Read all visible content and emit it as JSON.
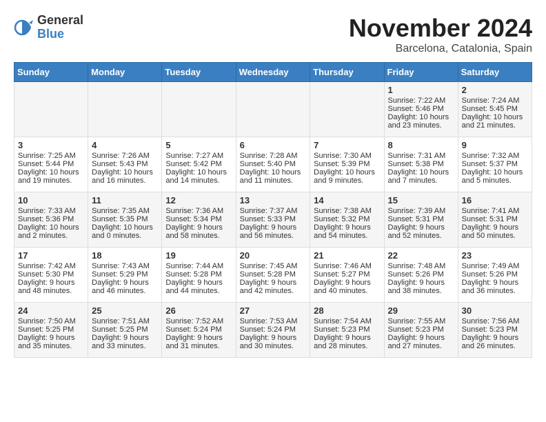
{
  "logo": {
    "line1": "General",
    "line2": "Blue"
  },
  "title": "November 2024",
  "location": "Barcelona, Catalonia, Spain",
  "weekdays": [
    "Sunday",
    "Monday",
    "Tuesday",
    "Wednesday",
    "Thursday",
    "Friday",
    "Saturday"
  ],
  "weeks": [
    [
      {
        "day": "",
        "sunrise": "",
        "sunset": "",
        "daylight": ""
      },
      {
        "day": "",
        "sunrise": "",
        "sunset": "",
        "daylight": ""
      },
      {
        "day": "",
        "sunrise": "",
        "sunset": "",
        "daylight": ""
      },
      {
        "day": "",
        "sunrise": "",
        "sunset": "",
        "daylight": ""
      },
      {
        "day": "",
        "sunrise": "",
        "sunset": "",
        "daylight": ""
      },
      {
        "day": "1",
        "sunrise": "Sunrise: 7:22 AM",
        "sunset": "Sunset: 5:46 PM",
        "daylight": "Daylight: 10 hours and 23 minutes."
      },
      {
        "day": "2",
        "sunrise": "Sunrise: 7:24 AM",
        "sunset": "Sunset: 5:45 PM",
        "daylight": "Daylight: 10 hours and 21 minutes."
      }
    ],
    [
      {
        "day": "3",
        "sunrise": "Sunrise: 7:25 AM",
        "sunset": "Sunset: 5:44 PM",
        "daylight": "Daylight: 10 hours and 19 minutes."
      },
      {
        "day": "4",
        "sunrise": "Sunrise: 7:26 AM",
        "sunset": "Sunset: 5:43 PM",
        "daylight": "Daylight: 10 hours and 16 minutes."
      },
      {
        "day": "5",
        "sunrise": "Sunrise: 7:27 AM",
        "sunset": "Sunset: 5:42 PM",
        "daylight": "Daylight: 10 hours and 14 minutes."
      },
      {
        "day": "6",
        "sunrise": "Sunrise: 7:28 AM",
        "sunset": "Sunset: 5:40 PM",
        "daylight": "Daylight: 10 hours and 11 minutes."
      },
      {
        "day": "7",
        "sunrise": "Sunrise: 7:30 AM",
        "sunset": "Sunset: 5:39 PM",
        "daylight": "Daylight: 10 hours and 9 minutes."
      },
      {
        "day": "8",
        "sunrise": "Sunrise: 7:31 AM",
        "sunset": "Sunset: 5:38 PM",
        "daylight": "Daylight: 10 hours and 7 minutes."
      },
      {
        "day": "9",
        "sunrise": "Sunrise: 7:32 AM",
        "sunset": "Sunset: 5:37 PM",
        "daylight": "Daylight: 10 hours and 5 minutes."
      }
    ],
    [
      {
        "day": "10",
        "sunrise": "Sunrise: 7:33 AM",
        "sunset": "Sunset: 5:36 PM",
        "daylight": "Daylight: 10 hours and 2 minutes."
      },
      {
        "day": "11",
        "sunrise": "Sunrise: 7:35 AM",
        "sunset": "Sunset: 5:35 PM",
        "daylight": "Daylight: 10 hours and 0 minutes."
      },
      {
        "day": "12",
        "sunrise": "Sunrise: 7:36 AM",
        "sunset": "Sunset: 5:34 PM",
        "daylight": "Daylight: 9 hours and 58 minutes."
      },
      {
        "day": "13",
        "sunrise": "Sunrise: 7:37 AM",
        "sunset": "Sunset: 5:33 PM",
        "daylight": "Daylight: 9 hours and 56 minutes."
      },
      {
        "day": "14",
        "sunrise": "Sunrise: 7:38 AM",
        "sunset": "Sunset: 5:32 PM",
        "daylight": "Daylight: 9 hours and 54 minutes."
      },
      {
        "day": "15",
        "sunrise": "Sunrise: 7:39 AM",
        "sunset": "Sunset: 5:31 PM",
        "daylight": "Daylight: 9 hours and 52 minutes."
      },
      {
        "day": "16",
        "sunrise": "Sunrise: 7:41 AM",
        "sunset": "Sunset: 5:31 PM",
        "daylight": "Daylight: 9 hours and 50 minutes."
      }
    ],
    [
      {
        "day": "17",
        "sunrise": "Sunrise: 7:42 AM",
        "sunset": "Sunset: 5:30 PM",
        "daylight": "Daylight: 9 hours and 48 minutes."
      },
      {
        "day": "18",
        "sunrise": "Sunrise: 7:43 AM",
        "sunset": "Sunset: 5:29 PM",
        "daylight": "Daylight: 9 hours and 46 minutes."
      },
      {
        "day": "19",
        "sunrise": "Sunrise: 7:44 AM",
        "sunset": "Sunset: 5:28 PM",
        "daylight": "Daylight: 9 hours and 44 minutes."
      },
      {
        "day": "20",
        "sunrise": "Sunrise: 7:45 AM",
        "sunset": "Sunset: 5:28 PM",
        "daylight": "Daylight: 9 hours and 42 minutes."
      },
      {
        "day": "21",
        "sunrise": "Sunrise: 7:46 AM",
        "sunset": "Sunset: 5:27 PM",
        "daylight": "Daylight: 9 hours and 40 minutes."
      },
      {
        "day": "22",
        "sunrise": "Sunrise: 7:48 AM",
        "sunset": "Sunset: 5:26 PM",
        "daylight": "Daylight: 9 hours and 38 minutes."
      },
      {
        "day": "23",
        "sunrise": "Sunrise: 7:49 AM",
        "sunset": "Sunset: 5:26 PM",
        "daylight": "Daylight: 9 hours and 36 minutes."
      }
    ],
    [
      {
        "day": "24",
        "sunrise": "Sunrise: 7:50 AM",
        "sunset": "Sunset: 5:25 PM",
        "daylight": "Daylight: 9 hours and 35 minutes."
      },
      {
        "day": "25",
        "sunrise": "Sunrise: 7:51 AM",
        "sunset": "Sunset: 5:25 PM",
        "daylight": "Daylight: 9 hours and 33 minutes."
      },
      {
        "day": "26",
        "sunrise": "Sunrise: 7:52 AM",
        "sunset": "Sunset: 5:24 PM",
        "daylight": "Daylight: 9 hours and 31 minutes."
      },
      {
        "day": "27",
        "sunrise": "Sunrise: 7:53 AM",
        "sunset": "Sunset: 5:24 PM",
        "daylight": "Daylight: 9 hours and 30 minutes."
      },
      {
        "day": "28",
        "sunrise": "Sunrise: 7:54 AM",
        "sunset": "Sunset: 5:23 PM",
        "daylight": "Daylight: 9 hours and 28 minutes."
      },
      {
        "day": "29",
        "sunrise": "Sunrise: 7:55 AM",
        "sunset": "Sunset: 5:23 PM",
        "daylight": "Daylight: 9 hours and 27 minutes."
      },
      {
        "day": "30",
        "sunrise": "Sunrise: 7:56 AM",
        "sunset": "Sunset: 5:23 PM",
        "daylight": "Daylight: 9 hours and 26 minutes."
      }
    ]
  ]
}
